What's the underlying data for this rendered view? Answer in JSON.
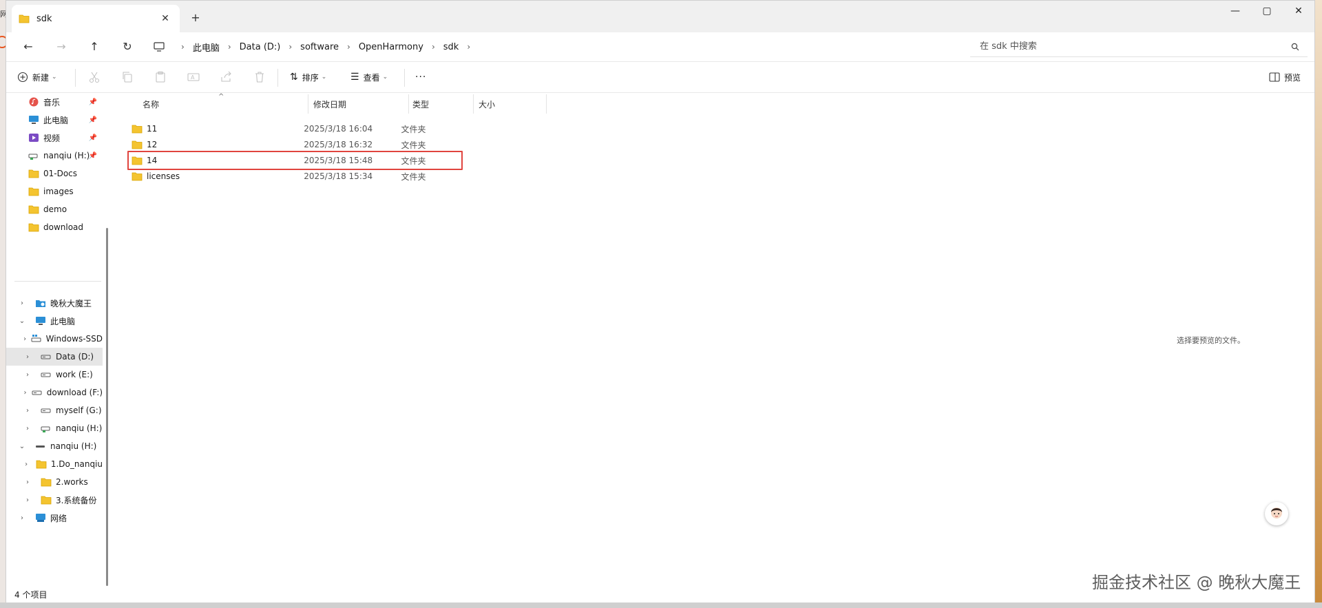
{
  "window": {
    "tab_title": "sdk",
    "tab_close": "✕",
    "new_tab": "+",
    "minimize": "—",
    "maximize": "▢",
    "close": "✕"
  },
  "address": {
    "crumbs": [
      "此电脑",
      "Data (D:)",
      "software",
      "OpenHarmony",
      "sdk"
    ],
    "search_placeholder": "在 sdk 中搜索"
  },
  "commands": {
    "new": "新建",
    "sort": "排序",
    "view": "查看",
    "more": "···",
    "preview": "预览"
  },
  "sidebar": {
    "quick": [
      {
        "label": "音乐",
        "icon": "music-icon",
        "pinned": true
      },
      {
        "label": "此电脑",
        "icon": "computer-icon",
        "pinned": true
      },
      {
        "label": "视频",
        "icon": "video-icon",
        "pinned": true
      },
      {
        "label": "nanqiu (H:)",
        "icon": "network-drive-icon",
        "pinned": true
      },
      {
        "label": "01-Docs",
        "icon": "folder-icon",
        "pinned": false
      },
      {
        "label": "images",
        "icon": "folder-icon",
        "pinned": false
      },
      {
        "label": "demo",
        "icon": "folder-icon",
        "pinned": false
      },
      {
        "label": "download",
        "icon": "folder-icon",
        "pinned": false
      }
    ],
    "tree": [
      {
        "label": "晚秋大魔王",
        "icon": "cloud-folder-icon",
        "chevron": "›",
        "indent": 0
      },
      {
        "label": "此电脑",
        "icon": "computer-icon",
        "chevron": "⌄",
        "indent": 0
      },
      {
        "label": "Windows-SSD",
        "icon": "windows-drive-icon",
        "chevron": "›",
        "indent": 1
      },
      {
        "label": "Data (D:)",
        "icon": "drive-icon",
        "chevron": "›",
        "indent": 1,
        "selected": true
      },
      {
        "label": "work (E:)",
        "icon": "drive-icon",
        "chevron": "›",
        "indent": 1
      },
      {
        "label": "download (F:)",
        "icon": "drive-icon",
        "chevron": "›",
        "indent": 1
      },
      {
        "label": "myself (G:)",
        "icon": "drive-icon",
        "chevron": "›",
        "indent": 1
      },
      {
        "label": "nanqiu (H:)",
        "icon": "network-drive-icon",
        "chevron": "›",
        "indent": 1
      },
      {
        "label": "nanqiu (H:)",
        "icon": "drive-flat-icon",
        "chevron": "⌄",
        "indent": 0
      },
      {
        "label": "1.Do_nanqiu",
        "icon": "folder-icon",
        "chevron": "›",
        "indent": 1
      },
      {
        "label": "2.works",
        "icon": "folder-icon",
        "chevron": "›",
        "indent": 1
      },
      {
        "label": "3.系统备份",
        "icon": "folder-icon",
        "chevron": "›",
        "indent": 1
      },
      {
        "label": "网络",
        "icon": "network-icon",
        "chevron": "›",
        "indent": 0
      }
    ]
  },
  "columns": {
    "name": "名称",
    "modified": "修改日期",
    "type": "类型",
    "size": "大小"
  },
  "files": [
    {
      "name": "11",
      "modified": "2025/3/18 16:04",
      "type": "文件夹"
    },
    {
      "name": "12",
      "modified": "2025/3/18 16:32",
      "type": "文件夹"
    },
    {
      "name": "14",
      "modified": "2025/3/18 15:48",
      "type": "文件夹",
      "highlighted": true
    },
    {
      "name": "licenses",
      "modified": "2025/3/18 15:34",
      "type": "文件夹"
    }
  ],
  "preview_empty": "选择要预览的文件。",
  "status": "4 个项目",
  "watermark": "掘金技术社区 @ 晚秋大魔王",
  "backdrop_fragment": "网",
  "colors": {
    "folder": "#f4c430",
    "highlight": "#e0443e",
    "selected_bg": "#e6e6e6"
  }
}
